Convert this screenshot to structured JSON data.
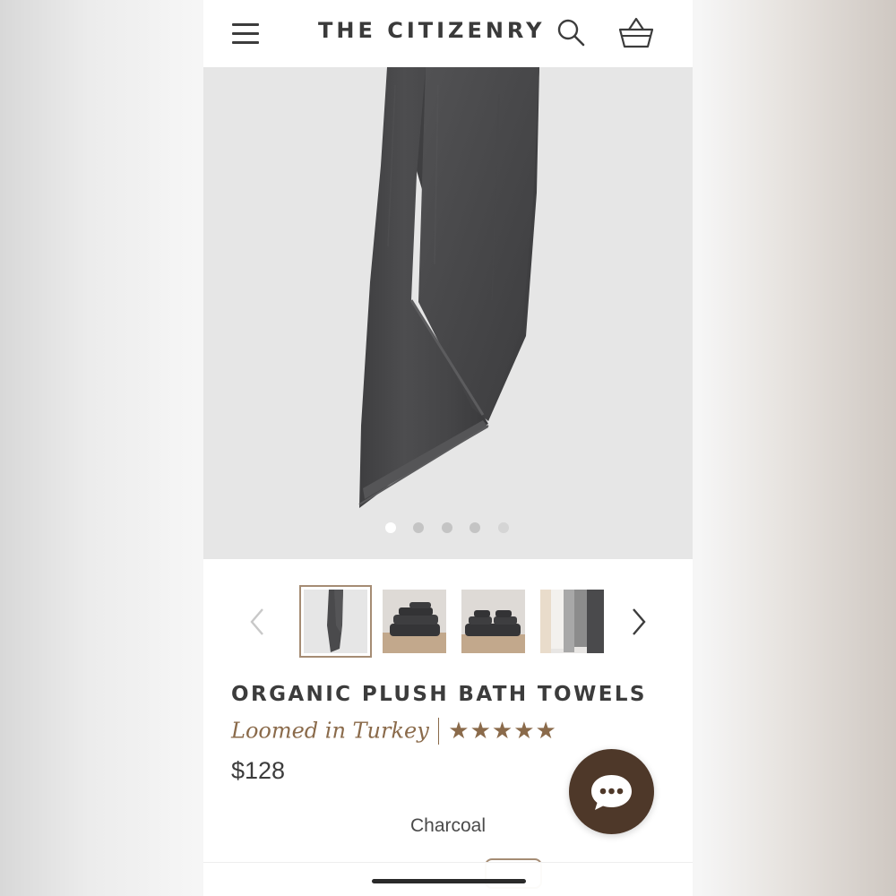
{
  "header": {
    "brand": "THE CITIZENRY",
    "icons": {
      "menu": "hamburger-menu-icon",
      "search": "search-icon",
      "cart": "basket-icon"
    }
  },
  "gallery": {
    "image_count": 5,
    "active_index": 0,
    "thumbnails": [
      {
        "subject": "hanging charcoal towel",
        "selected": true
      },
      {
        "subject": "stacked charcoal towels"
      },
      {
        "subject": "stacked charcoal towel set"
      },
      {
        "subject": "hanging towels in multiple colors"
      }
    ]
  },
  "product": {
    "title": "ORGANIC PLUSH BATH TOWELS",
    "origin": "Loomed in Turkey",
    "rating": 5,
    "rating_max": 5,
    "price": "$128",
    "selected_color": "Charcoal"
  },
  "chat": {
    "icon": "chat-bubble-icon"
  },
  "colors": {
    "brand_text": "#3a3a3a",
    "accent_brown": "#8a6a4a",
    "chat_button": "#4e3829",
    "towel_charcoal": "#4a4a4c"
  }
}
